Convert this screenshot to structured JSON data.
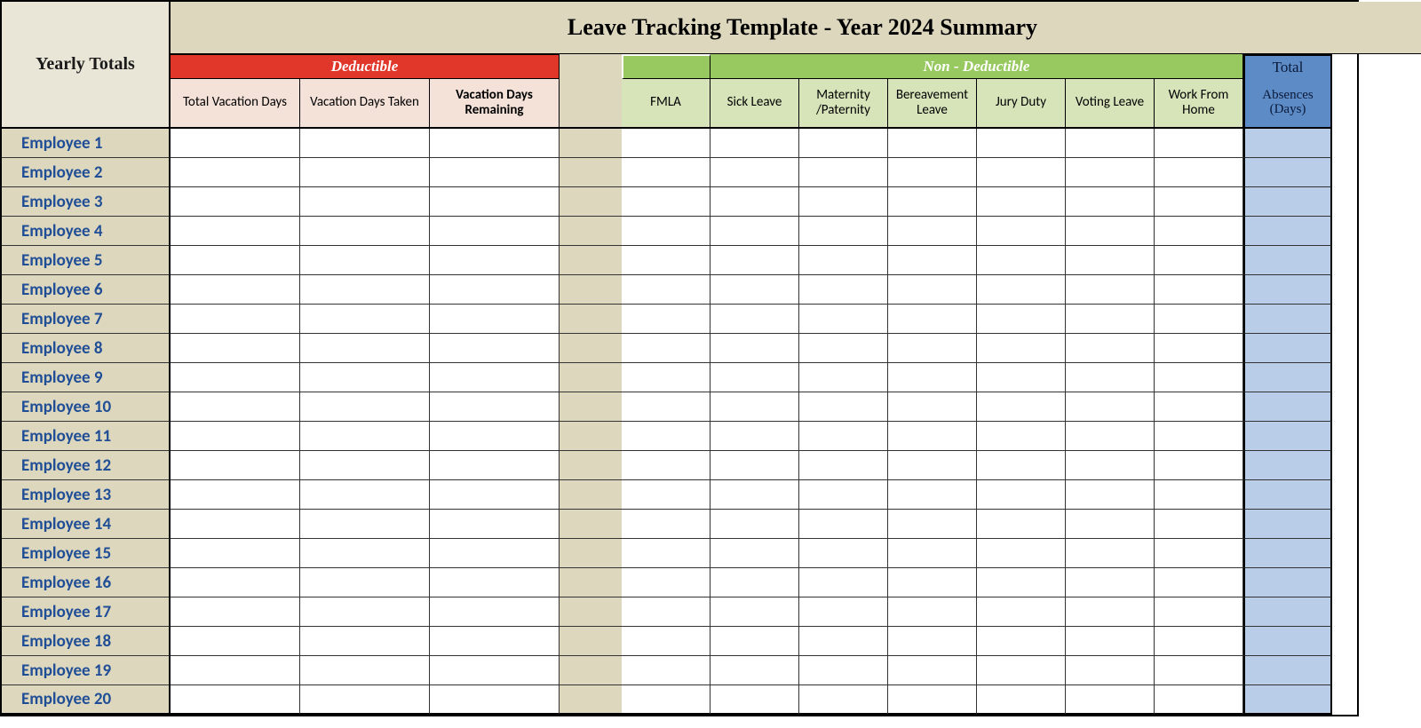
{
  "corner_label": "Yearly Totals",
  "title": "Leave Tracking Template - Year 2024 Summary",
  "deductible": {
    "header": "Deductible",
    "columns": [
      "Total Vacation Days",
      "Vacation Days Taken",
      "Vacation Days Remaining"
    ]
  },
  "non_deductible": {
    "header": "Non - Deductible",
    "columns": [
      "FMLA",
      "Sick Leave",
      "Maternity /Paternity",
      "Bereavement Leave",
      "Jury Duty",
      "Voting Leave",
      "Work From Home"
    ]
  },
  "total_header": {
    "line1": "Total",
    "line2": "Absences",
    "line3": "(Days)"
  },
  "employees": [
    "Employee 1",
    "Employee 2",
    "Employee 3",
    "Employee 4",
    "Employee 5",
    "Employee 6",
    "Employee 7",
    "Employee 8",
    "Employee 9",
    "Employee 10",
    "Employee 11",
    "Employee 12",
    "Employee 13",
    "Employee 14",
    "Employee 15",
    "Employee 16",
    "Employee 17",
    "Employee 18",
    "Employee 19",
    "Employee 20"
  ]
}
